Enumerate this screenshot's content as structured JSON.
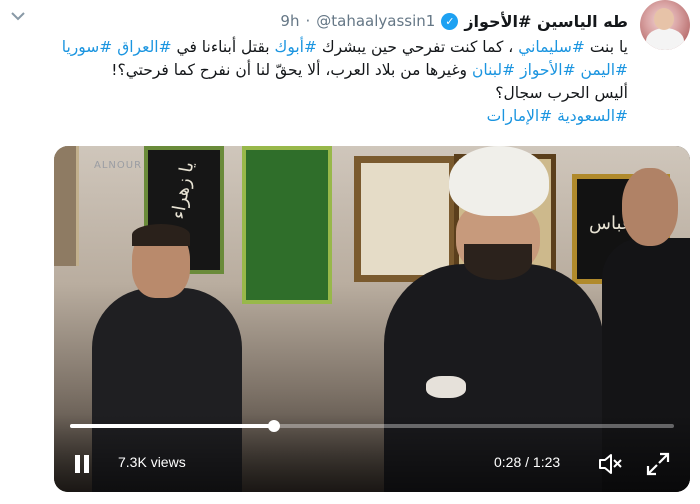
{
  "tweet": {
    "display_name": "طه الياسين #الأحواز",
    "handle": "@tahaalyassin1",
    "separator": "·",
    "time_ago": "9h",
    "verified_mark": "✓",
    "body_lines": [
      [
        {
          "text": "يا بنت ",
          "tag": false
        },
        {
          "text": "#سليماني",
          "tag": true
        },
        {
          "text": " ، كما كنت تفرحي حين يبشرك ",
          "tag": false
        },
        {
          "text": "#أبوك",
          "tag": true
        },
        {
          "text": " بقتل أبناءنا في ",
          "tag": false
        },
        {
          "text": "#العراق",
          "tag": true
        },
        {
          "text": " ",
          "tag": false
        },
        {
          "text": "#سوريا",
          "tag": true
        }
      ],
      [
        {
          "text": "#اليمن",
          "tag": true
        },
        {
          "text": " ",
          "tag": false
        },
        {
          "text": "#الأحواز",
          "tag": true
        },
        {
          "text": " ",
          "tag": false
        },
        {
          "text": "#لبنان",
          "tag": true
        },
        {
          "text": " وغيرها من بلاد العرب، ألا يحقّ لنا أن نفرح كما فرحتي؟!",
          "tag": false
        }
      ],
      [
        {
          "text": "أليس الحرب سجال؟",
          "tag": false
        }
      ],
      [
        {
          "text": "#السعودية",
          "tag": true
        },
        {
          "text": " ",
          "tag": false
        },
        {
          "text": "#الإمارات",
          "tag": true
        }
      ]
    ]
  },
  "video": {
    "watermark": "ALNOUR",
    "views": "7.3K views",
    "time": "0:28 / 1:23",
    "progress_fraction": 0.337,
    "calligraphy_1": "يا زهراء",
    "calligraphy_2": "يا عباس"
  },
  "icons": {
    "caret": "chevron-down-icon",
    "pause": "pause-icon",
    "mute": "volume-muted-icon",
    "fullscreen": "fullscreen-icon"
  },
  "colors": {
    "link": "#1b95e0",
    "verified": "#1da1f2",
    "text": "#14171a",
    "muted": "#657786"
  }
}
